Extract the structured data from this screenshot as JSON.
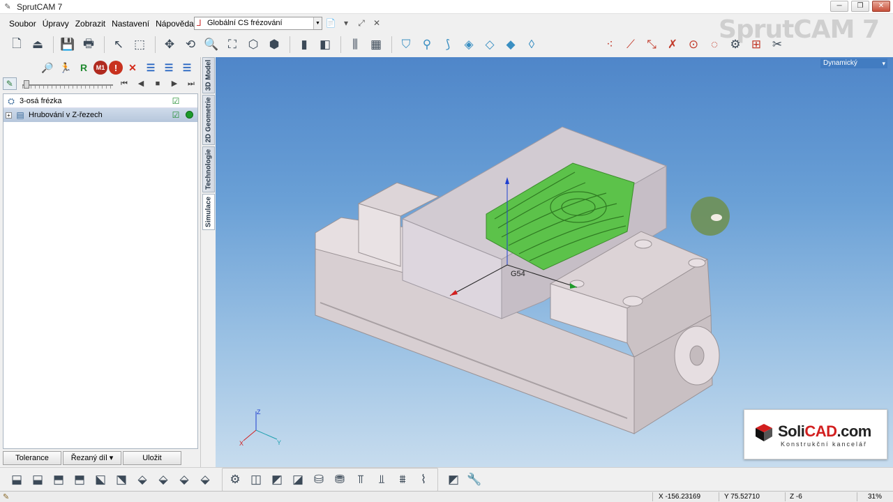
{
  "window": {
    "title": "SprutCAM 7",
    "buttons": [
      "─",
      "❐",
      "✕"
    ]
  },
  "menu": {
    "items": [
      "Soubor",
      "Úpravy",
      "Zobrazit",
      "Nastavení",
      "Nápověda"
    ]
  },
  "cs_select": {
    "value": "Globální CS frézování"
  },
  "watermark": {
    "text": "SprutCAM 7"
  },
  "left_panel": {
    "tree": [
      {
        "label": "3-osá frézka"
      },
      {
        "label": "Hrubování v Z-řezech"
      }
    ],
    "buttons": {
      "tolerance": "Tolerance",
      "cut_part": "Řezaný díl",
      "save": "Uložit"
    },
    "toolbar_m1": "M1",
    "toolbar_r": "R"
  },
  "vertical_tabs": [
    "3D Model",
    "2D Geometrie",
    "Technologie",
    "Simulace"
  ],
  "viewport": {
    "mode": "Dynamický",
    "cs_label": "G54",
    "axes": {
      "x": "X",
      "y": "Y",
      "z": "Z"
    },
    "colors": {
      "bg_top": "#4f86c9",
      "bg_bottom": "#c7dcee",
      "part": "#d9d0d2",
      "stock_cut": "#5cc24a"
    }
  },
  "solicad": {
    "brand_prefix": "Soli",
    "brand_accent": "CAD",
    "brand_suffix": ".com",
    "tagline": "Konstrukční kancelář"
  },
  "status": {
    "x": "X -156.23169",
    "y": "Y 75.52710",
    "z": "Z -6",
    "zoom": "31%"
  }
}
